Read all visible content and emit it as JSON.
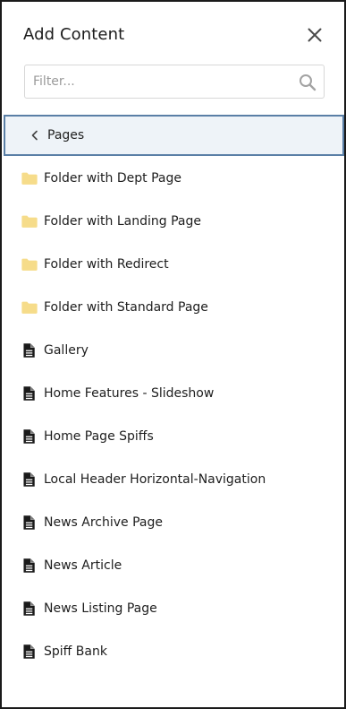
{
  "panel": {
    "title": "Add Content",
    "close_icon": "close-icon"
  },
  "filter": {
    "placeholder": "Filter...",
    "value": "",
    "icon": "search-icon"
  },
  "breadcrumb": {
    "label": "Pages",
    "icon": "chevron-left-icon"
  },
  "colors": {
    "folder": "#f6dc8a",
    "document": "#1a1a1a",
    "breadcrumb_border": "#5a7fa6",
    "breadcrumb_bg": "#eef3f8"
  },
  "items": [
    {
      "label": "Folder with Dept Page",
      "type": "folder"
    },
    {
      "label": "Folder with Landing Page",
      "type": "folder"
    },
    {
      "label": "Folder with Redirect",
      "type": "folder"
    },
    {
      "label": "Folder with Standard Page",
      "type": "folder"
    },
    {
      "label": "Gallery",
      "type": "document"
    },
    {
      "label": "Home Features - Slideshow",
      "type": "document"
    },
    {
      "label": "Home Page Spiffs",
      "type": "document"
    },
    {
      "label": "Local Header Horizontal-Navigation",
      "type": "document"
    },
    {
      "label": "News Archive Page",
      "type": "document"
    },
    {
      "label": "News Article",
      "type": "document"
    },
    {
      "label": "News Listing Page",
      "type": "document"
    },
    {
      "label": "Spiff Bank",
      "type": "document"
    }
  ]
}
